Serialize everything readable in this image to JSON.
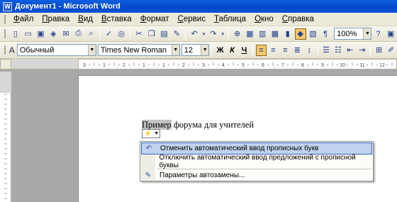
{
  "window": {
    "title": "Документ1 - Microsoft Word",
    "app_icon": "W"
  },
  "menubar": {
    "items": [
      {
        "label": "Файл"
      },
      {
        "label": "Правка"
      },
      {
        "label": "Вид"
      },
      {
        "label": "Вставка"
      },
      {
        "label": "Формат"
      },
      {
        "label": "Сервис"
      },
      {
        "label": "Таблица"
      },
      {
        "label": "Окно"
      },
      {
        "label": "Справка"
      }
    ]
  },
  "standard_toolbar": {
    "zoom": "100%",
    "icons": [
      "new-icon",
      "open-icon",
      "save-icon",
      "permission-icon",
      "email-icon",
      "print-icon",
      "print-preview-icon",
      "spelling-icon",
      "research-icon",
      "cut-icon",
      "copy-icon",
      "paste-icon",
      "format-painter-icon",
      "undo-icon",
      "redo-icon",
      "hyperlink-icon",
      "tables-borders-icon",
      "insert-table-icon",
      "insert-excel-icon",
      "columns-icon",
      "drawing-icon",
      "document-map-icon",
      "show-formatting-icon"
    ]
  },
  "formatting_toolbar": {
    "style": "Обычный",
    "font": "Times New Roman",
    "size": "12",
    "bold": "Ж",
    "italic": "К",
    "underline": "Ч",
    "paragraph_mark": "¶"
  },
  "ruler": {
    "labels": [
      "3",
      "1",
      "2",
      "1",
      "1",
      "2",
      "3",
      "4",
      "5",
      "6",
      "7",
      "8",
      "9",
      "10",
      "11",
      "12"
    ]
  },
  "document": {
    "highlighted_word": "Пример",
    "text_rest": " форума для учителей"
  },
  "autocorrect_menu": {
    "items": [
      {
        "label": "Отменить автоматический ввод прописных букв"
      },
      {
        "label": "Отключить автоматический ввод предложений с прописной буквы"
      },
      {
        "label": "Параметры автозамены..."
      }
    ]
  },
  "colors": {
    "titlebar": "#0548c8",
    "menu_hover": "#c1d2ee",
    "toolbar_bg": "#ece9d8"
  }
}
